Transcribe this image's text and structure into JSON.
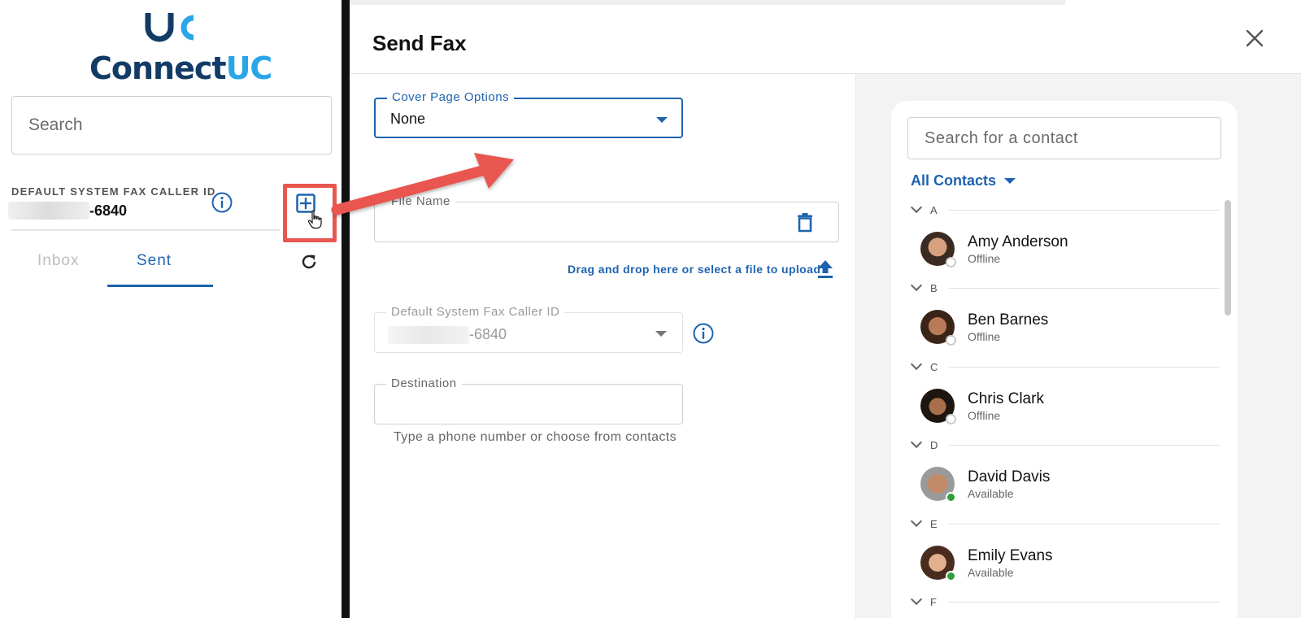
{
  "left_panel": {
    "logo_text_main": "Connect",
    "logo_text_accent": "UC",
    "search_placeholder": "Search",
    "caller_id_label": "DEFAULT SYSTEM FAX CALLER ID",
    "caller_id_suffix": "-6840",
    "tabs": [
      {
        "label": "Inbox",
        "active": false
      },
      {
        "label": "Sent",
        "active": true
      }
    ]
  },
  "dialog": {
    "title": "Send Fax",
    "cover_page": {
      "label": "Cover Page Options",
      "value": "None"
    },
    "file_name": {
      "label": "File Name"
    },
    "upload_text": "Drag and drop here or select a file to upload",
    "caller_id": {
      "label": "Default System Fax Caller ID",
      "suffix": "-6840"
    },
    "destination": {
      "label": "Destination",
      "hint": "Type a phone number or choose from contacts"
    }
  },
  "contacts": {
    "search_placeholder": "Search for a contact",
    "filter_label": "All Contacts",
    "groups": [
      {
        "letter": "A",
        "name": "Amy Anderson",
        "status": "Offline"
      },
      {
        "letter": "B",
        "name": "Ben Barnes",
        "status": "Offline"
      },
      {
        "letter": "C",
        "name": "Chris Clark",
        "status": "Offline"
      },
      {
        "letter": "D",
        "name": "David Davis",
        "status": "Available"
      },
      {
        "letter": "E",
        "name": "Emily Evans",
        "status": "Available"
      },
      {
        "letter": "F"
      }
    ]
  },
  "colors": {
    "accent_blue": "#1e63b0",
    "logo_navy": "#123b66",
    "logo_cyan": "#2aa6e8",
    "highlight_red": "#e8574f",
    "available_green": "#2e9e3e"
  },
  "icons": [
    "info-icon",
    "add-square-icon",
    "hand-pointer-icon",
    "refresh-icon",
    "close-icon",
    "dropdown-caret-icon",
    "trash-icon",
    "upload-icon",
    "chevron-down-icon"
  ]
}
